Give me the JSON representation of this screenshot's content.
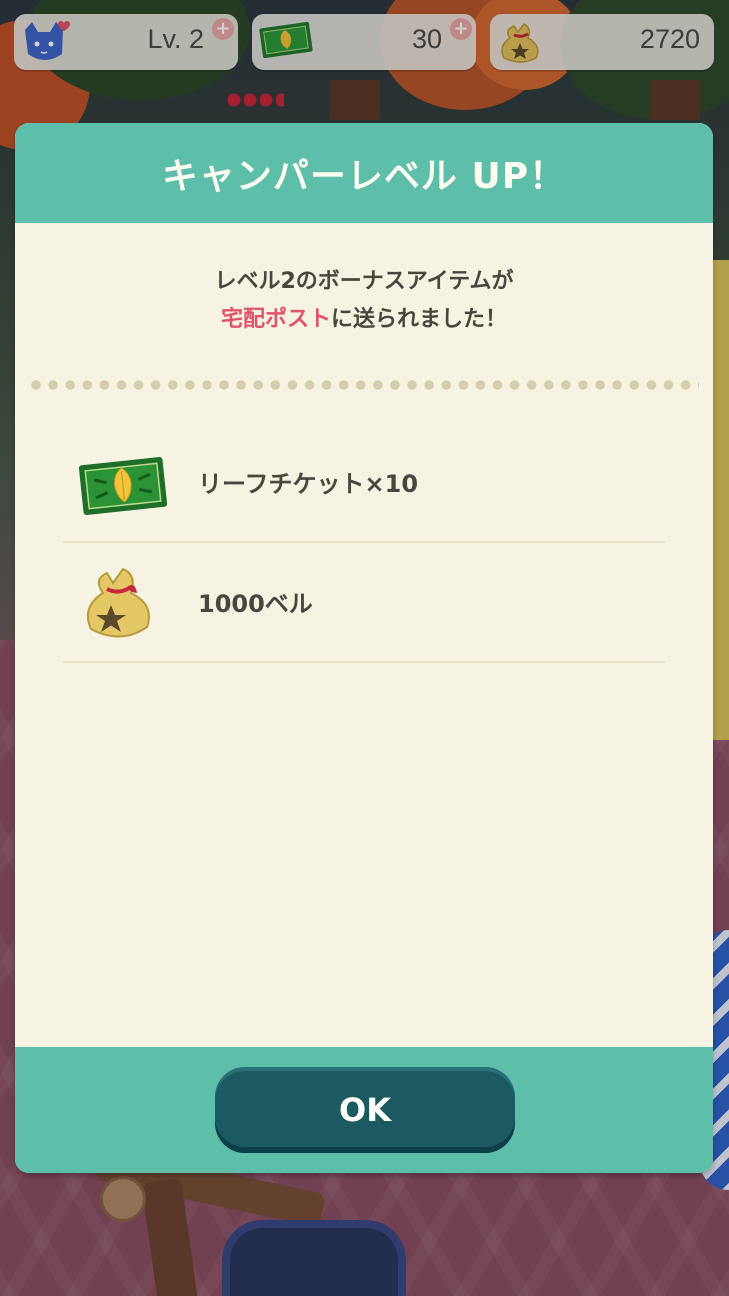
{
  "hud": {
    "level_label": "Lv. 2",
    "level_plus": "+",
    "tickets_value": "30",
    "tickets_plus": "+",
    "bells_value": "2720"
  },
  "dialog": {
    "title": "キャンパーレベル UP！",
    "message_line1": "レベル2のボーナスアイテムが",
    "message_highlight": "宅配ポスト",
    "message_line2_rest": "に送られました！",
    "rewards": [
      {
        "label": "リーフチケット×10",
        "icon": "leaf-ticket-icon"
      },
      {
        "label": "1000ベル",
        "icon": "bell-bag-icon"
      }
    ],
    "ok_label": "OK"
  },
  "colors": {
    "header": "#5dbfaa",
    "panel": "#f7f3e3",
    "button": "#1c5a62",
    "highlight": "#e0536a"
  }
}
